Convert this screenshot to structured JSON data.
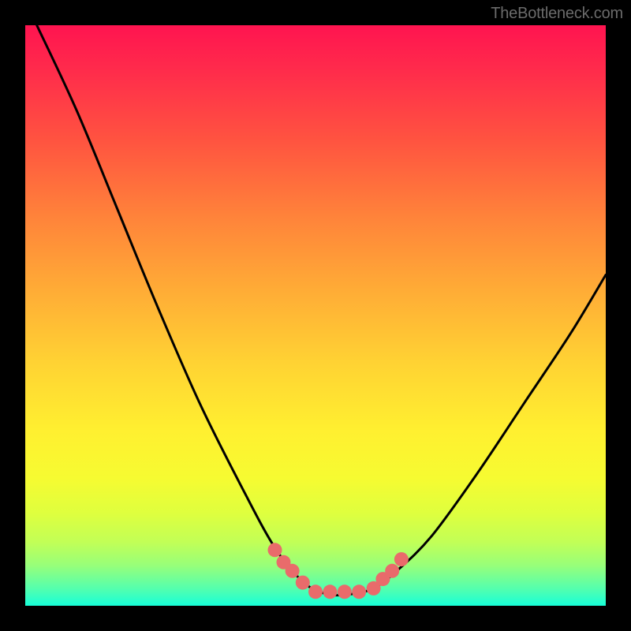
{
  "attribution": "TheBottleneck.com",
  "chart_data": {
    "type": "line",
    "title": "",
    "xlabel": "",
    "ylabel": "",
    "xlim": [
      0,
      1
    ],
    "ylim": [
      0,
      1
    ],
    "series": [
      {
        "name": "curve",
        "x": [
          0.02,
          0.09,
          0.16,
          0.23,
          0.3,
          0.37,
          0.43,
          0.48,
          0.52,
          0.56,
          0.6,
          0.64,
          0.7,
          0.78,
          0.86,
          0.94,
          1.0
        ],
        "values": [
          1.0,
          0.85,
          0.68,
          0.51,
          0.35,
          0.21,
          0.1,
          0.04,
          0.02,
          0.02,
          0.03,
          0.06,
          0.12,
          0.23,
          0.35,
          0.47,
          0.57
        ]
      }
    ],
    "markers": {
      "color": "#e96b6b",
      "x": [
        0.43,
        0.445,
        0.46,
        0.478,
        0.5,
        0.525,
        0.55,
        0.575,
        0.6,
        0.616,
        0.632,
        0.648
      ],
      "values": [
        0.096,
        0.075,
        0.06,
        0.04,
        0.024,
        0.024,
        0.024,
        0.024,
        0.03,
        0.046,
        0.06,
        0.08
      ]
    },
    "background_gradient": {
      "direction": "top-to-bottom",
      "stops": [
        {
          "pos": 0.0,
          "color": "#ff1450"
        },
        {
          "pos": 0.08,
          "color": "#ff2c4b"
        },
        {
          "pos": 0.2,
          "color": "#ff5440"
        },
        {
          "pos": 0.33,
          "color": "#ff833a"
        },
        {
          "pos": 0.46,
          "color": "#ffad36"
        },
        {
          "pos": 0.58,
          "color": "#ffd233"
        },
        {
          "pos": 0.7,
          "color": "#fff030"
        },
        {
          "pos": 0.78,
          "color": "#f6fb31"
        },
        {
          "pos": 0.84,
          "color": "#dfff3e"
        },
        {
          "pos": 0.89,
          "color": "#c2ff56"
        },
        {
          "pos": 0.93,
          "color": "#98ff79"
        },
        {
          "pos": 0.97,
          "color": "#55ffad"
        },
        {
          "pos": 1.0,
          "color": "#17ffd8"
        }
      ]
    }
  }
}
